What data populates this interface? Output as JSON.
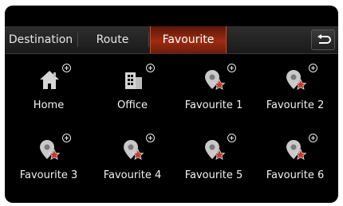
{
  "tabs": [
    {
      "label": "Destination"
    },
    {
      "label": "Route"
    },
    {
      "label": "Favourite"
    }
  ],
  "back_icon": "return-arrow-icon",
  "favourites": [
    {
      "label": "Home",
      "icon": "home-icon"
    },
    {
      "label": "Office",
      "icon": "office-building-icon"
    },
    {
      "label": "Favourite 1",
      "icon": "favourite-pin-icon"
    },
    {
      "label": "Favourite 2",
      "icon": "favourite-pin-icon"
    },
    {
      "label": "Favourite 3",
      "icon": "favourite-pin-icon"
    },
    {
      "label": "Favourite 4",
      "icon": "favourite-pin-icon"
    },
    {
      "label": "Favourite 5",
      "icon": "favourite-pin-icon"
    },
    {
      "label": "Favourite 6",
      "icon": "favourite-pin-icon"
    }
  ],
  "colors": {
    "active_tab": "#9c2d12",
    "pin": "#c9c9c9",
    "star": "#c0392b"
  }
}
